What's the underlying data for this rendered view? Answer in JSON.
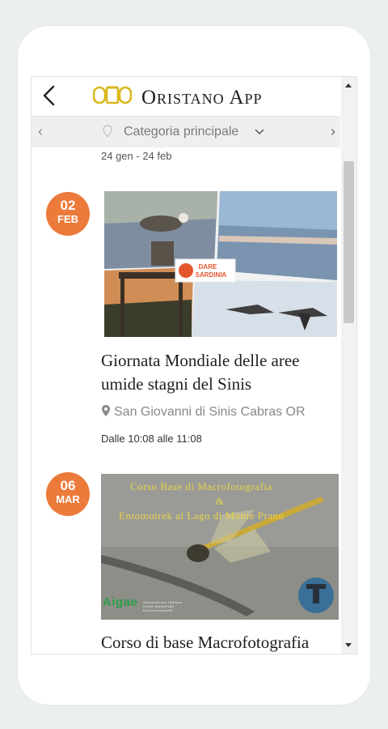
{
  "app": {
    "title": "Oristano App",
    "logo": "OTO"
  },
  "category": {
    "label": "Categoria principale",
    "prev": "‹",
    "next": "›"
  },
  "date_range": "24 gen - 24 feb",
  "events": [
    {
      "day": "02",
      "month": "FEB",
      "title": "Giornata Mondiale delle aree umide stagni del Sinis",
      "location": "San Giovanni di Sinis Cabras OR",
      "time": "Dalle 10:08 alle 11:08",
      "image_badge": {
        "line1": "DARE",
        "line2": "SARDINIA"
      }
    },
    {
      "day": "06",
      "month": "MAR",
      "title": "Corso di base Macrofotografia",
      "image_text": {
        "line1": "Corso Base di Macrofotografia",
        "line2": "&",
        "line3": "Entomotrek al Lago di Monte Pranu",
        "logo": "Aigae",
        "logo_sub": "Associazione Italiana Guide Ambientali Escursionistiche"
      }
    }
  ],
  "colors": {
    "badge": "#ec7a3a",
    "logo": "#d9b71c"
  }
}
